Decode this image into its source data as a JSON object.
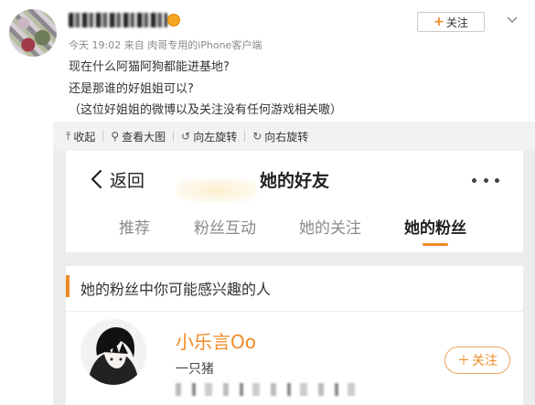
{
  "post": {
    "meta": "今天 19:02 来自 肉哥专用的iPhone客户端",
    "follow_label": "关注",
    "lines": [
      "现在什么阿猫阿狗都能进基地?",
      "还是那谁的好姐姐可以?",
      "（这位好姐姐的微博以及关注没有任何游戏相关嗷）"
    ]
  },
  "image_toolbar": {
    "collapse": "收起",
    "view_large": "查看大图",
    "rotate_left": "向左旋转",
    "rotate_right": "向右旋转"
  },
  "screenshot": {
    "back_label": "返回",
    "title": "她的好友",
    "tabs": [
      "推荐",
      "粉丝互动",
      "她的关注",
      "她的粉丝"
    ],
    "active_tab": "她的粉丝",
    "section_title": "她的粉丝中你可能感兴趣的人",
    "fan": {
      "name": "小乐言Oo",
      "bio": "一只猪",
      "follow_label": "关注"
    }
  },
  "colors": {
    "accent": "#f08a24",
    "toolbar_bg": "#f2f2f2"
  }
}
